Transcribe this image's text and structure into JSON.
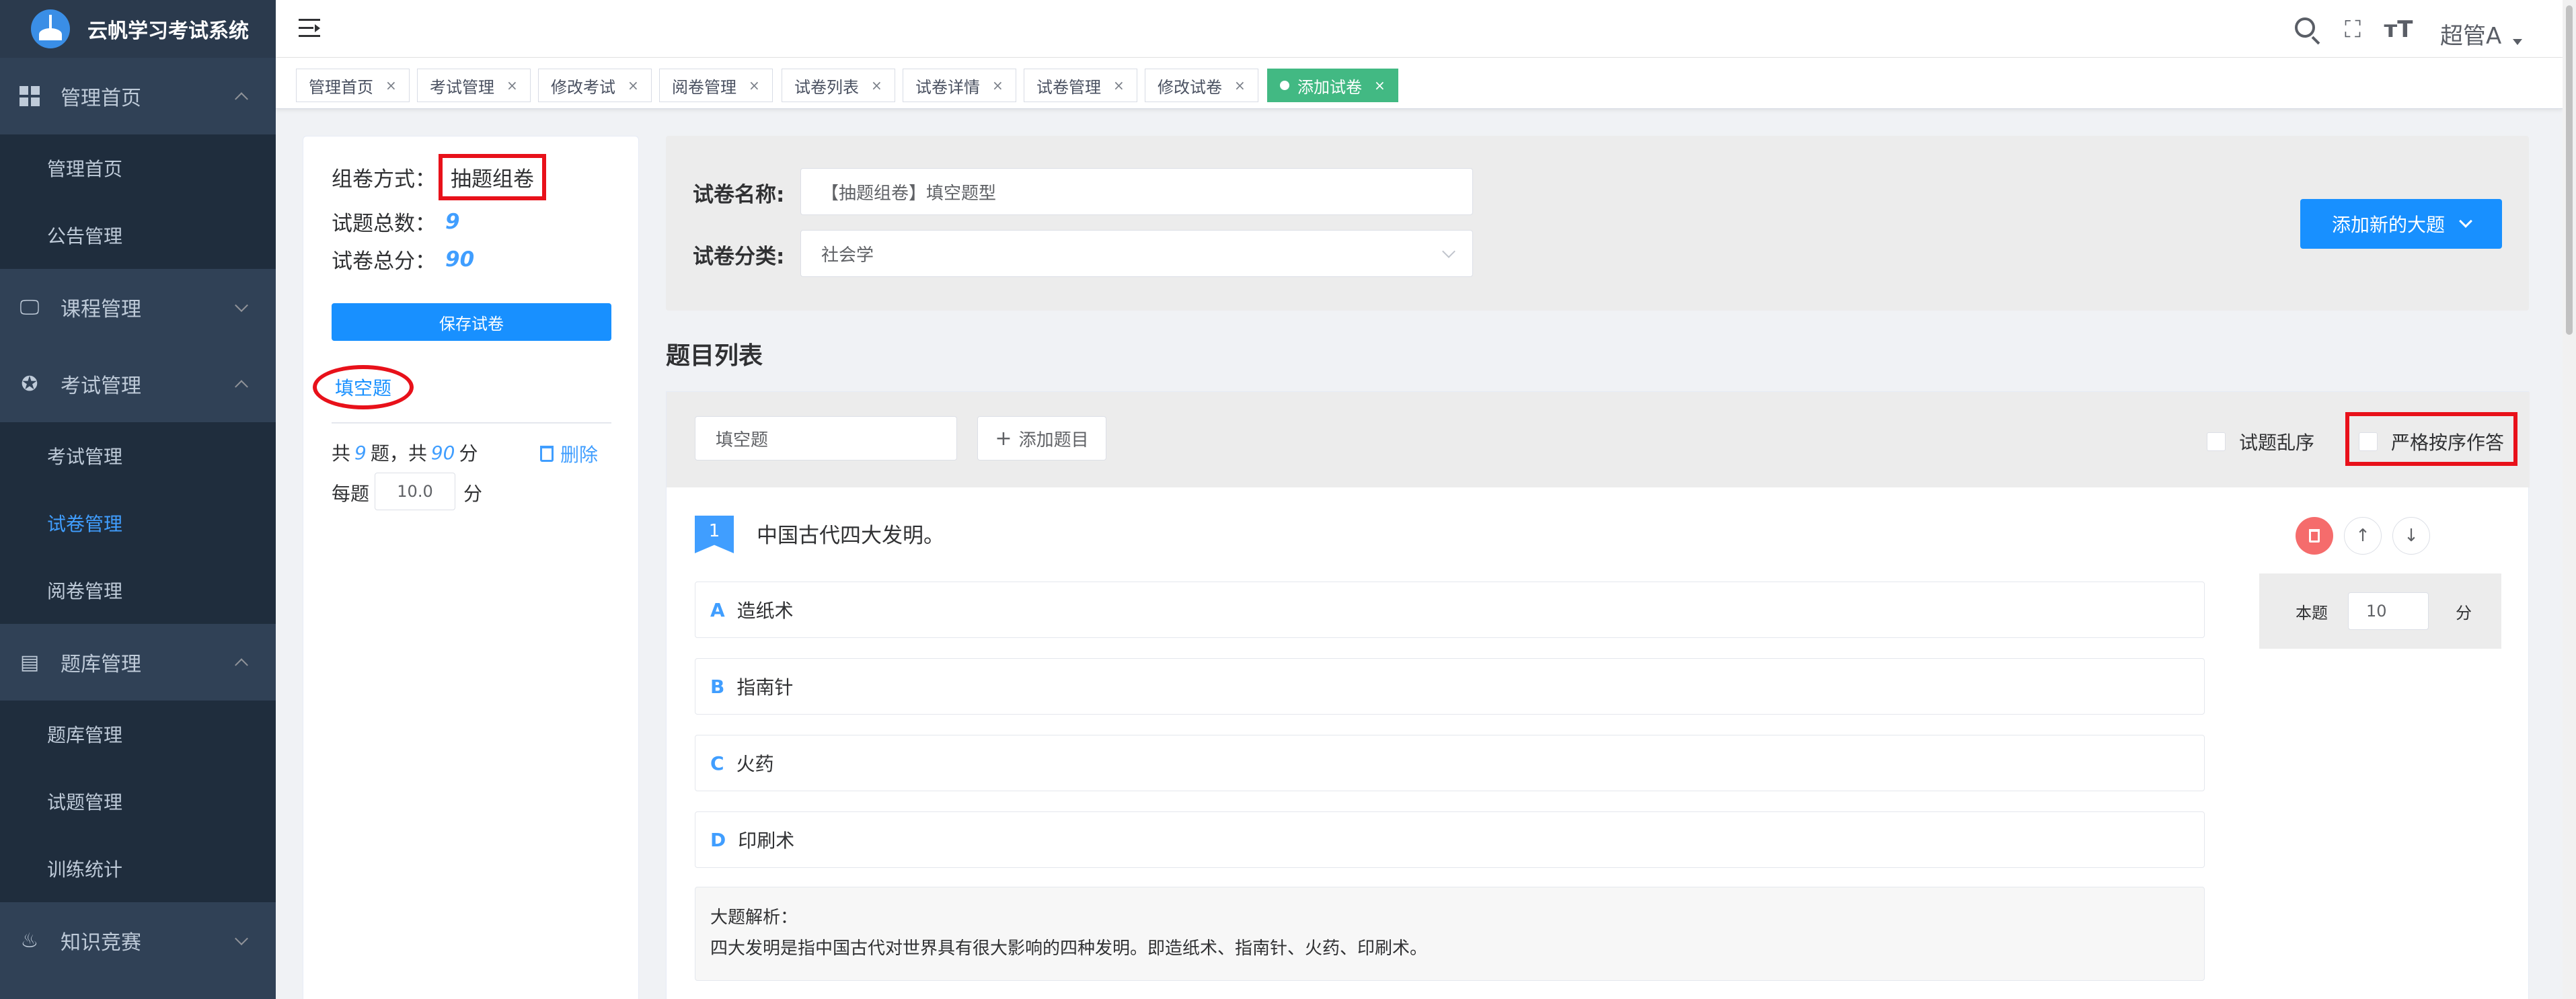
{
  "app": {
    "title": "云帆学习考试系统"
  },
  "sidebar": {
    "groups": [
      {
        "label": "管理首页",
        "icon": "dashboard-icon",
        "expanded": true,
        "items": [
          "管理首页",
          "公告管理"
        ]
      },
      {
        "label": "课程管理",
        "icon": "monitor-icon",
        "expanded": false,
        "items": []
      },
      {
        "label": "考试管理",
        "icon": "settings-icon",
        "expanded": true,
        "items": [
          "考试管理",
          "试卷管理",
          "阅卷管理"
        ]
      },
      {
        "label": "题库管理",
        "icon": "document-icon",
        "expanded": true,
        "items": [
          "题库管理",
          "试题管理",
          "训练统计"
        ]
      },
      {
        "label": "知识竞赛",
        "icon": "fire-icon",
        "expanded": false,
        "items": []
      }
    ],
    "active_item": "试卷管理"
  },
  "header": {
    "user": "超管A",
    "icons": [
      "search-icon",
      "fullscreen-icon",
      "font-size-icon"
    ]
  },
  "tags": [
    {
      "label": "管理首页",
      "active": false
    },
    {
      "label": "考试管理",
      "active": false
    },
    {
      "label": "修改考试",
      "active": false
    },
    {
      "label": "阅卷管理",
      "active": false
    },
    {
      "label": "试卷列表",
      "active": false
    },
    {
      "label": "试卷详情",
      "active": false
    },
    {
      "label": "试卷管理",
      "active": false
    },
    {
      "label": "修改试卷",
      "active": false
    },
    {
      "label": "添加试卷",
      "active": true
    }
  ],
  "left_panel": {
    "method_label": "组卷方式：",
    "method_value": "抽题组卷",
    "total_q_label": "试题总数：",
    "total_q": "9",
    "total_score_label": "试卷总分：",
    "total_score": "90",
    "save_button": "保存试卷",
    "type_name": "填空题",
    "summary_pre": "共",
    "summary_count": "9",
    "summary_mid": "题，共",
    "summary_score": "90",
    "summary_unit": "分",
    "delete_label": "删除",
    "per_label": "每题",
    "per_value": "10.0",
    "per_unit": "分"
  },
  "form": {
    "name_label": "试卷名称:",
    "name_value": "【抽题组卷】填空题型",
    "category_label": "试卷分类:",
    "category_value": "社会学",
    "add_major_button": "添加新的大题"
  },
  "question_list": {
    "title": "题目列表",
    "type_input": "填空题",
    "add_question_button": "添加题目",
    "shuffle_label": "试题乱序",
    "strict_label": "严格按序作答",
    "questions": [
      {
        "number": "1",
        "stem": "中国古代四大发明。",
        "options": [
          {
            "letter": "A",
            "text": "造纸术"
          },
          {
            "letter": "B",
            "text": "指南针"
          },
          {
            "letter": "C",
            "text": "火药"
          },
          {
            "letter": "D",
            "text": "印刷术"
          }
        ],
        "analysis_title": "大题解析：",
        "analysis_text": "四大发明是指中国古代对世界具有很大影响的四种发明。即造纸术、指南针、火药、印刷术。",
        "score_label": "本题",
        "score_value": "10",
        "score_unit": "分"
      }
    ]
  }
}
